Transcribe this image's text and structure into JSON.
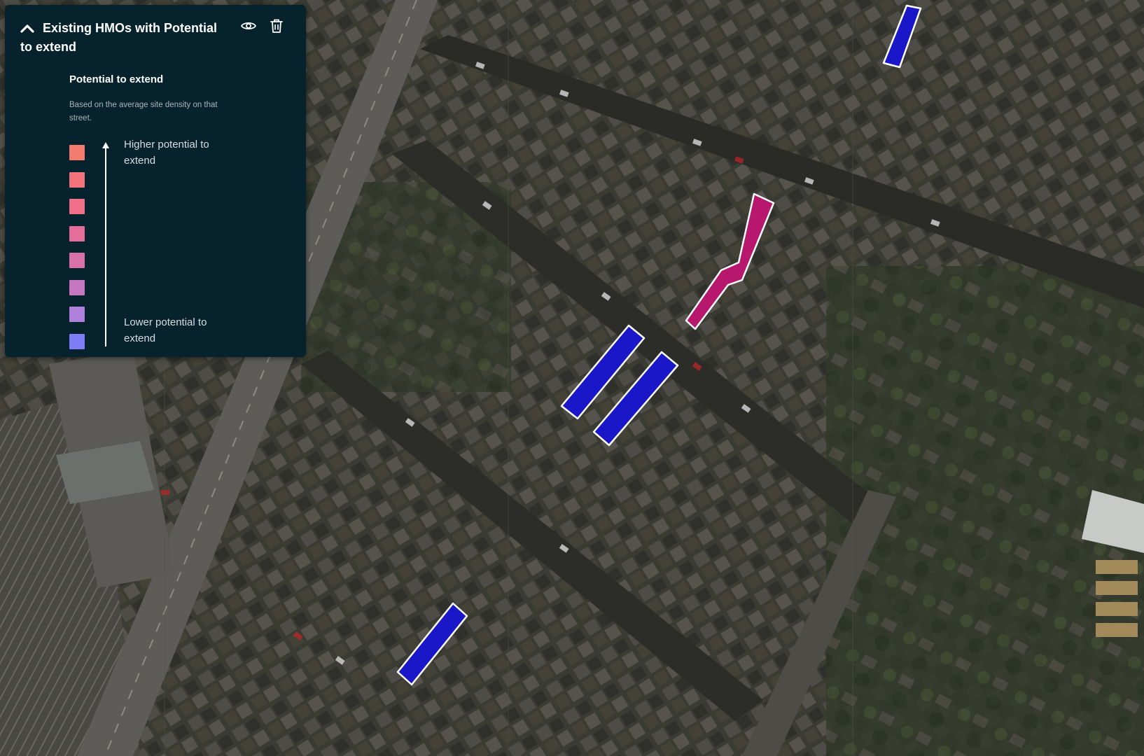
{
  "panel": {
    "title": "Existing HMOs with Potential to extend",
    "icons": {
      "collapse": "chevron-up-icon",
      "visibility": "eye-icon",
      "delete": "trash-icon"
    }
  },
  "legend": {
    "heading": "Potential to extend",
    "description": "Based on the average site density on that street.",
    "high_label": "Higher potential to extend",
    "low_label": "Lower potential to extend",
    "scale_colors": [
      "#f47c6e",
      "#f2737c",
      "#ef6f88",
      "#e46e99",
      "#d972aa",
      "#c776c2",
      "#ae7fdb",
      "#7d7ef5"
    ]
  },
  "map": {
    "highlight_colors": {
      "high": "#b8176e",
      "low": "#1a17c9"
    }
  }
}
